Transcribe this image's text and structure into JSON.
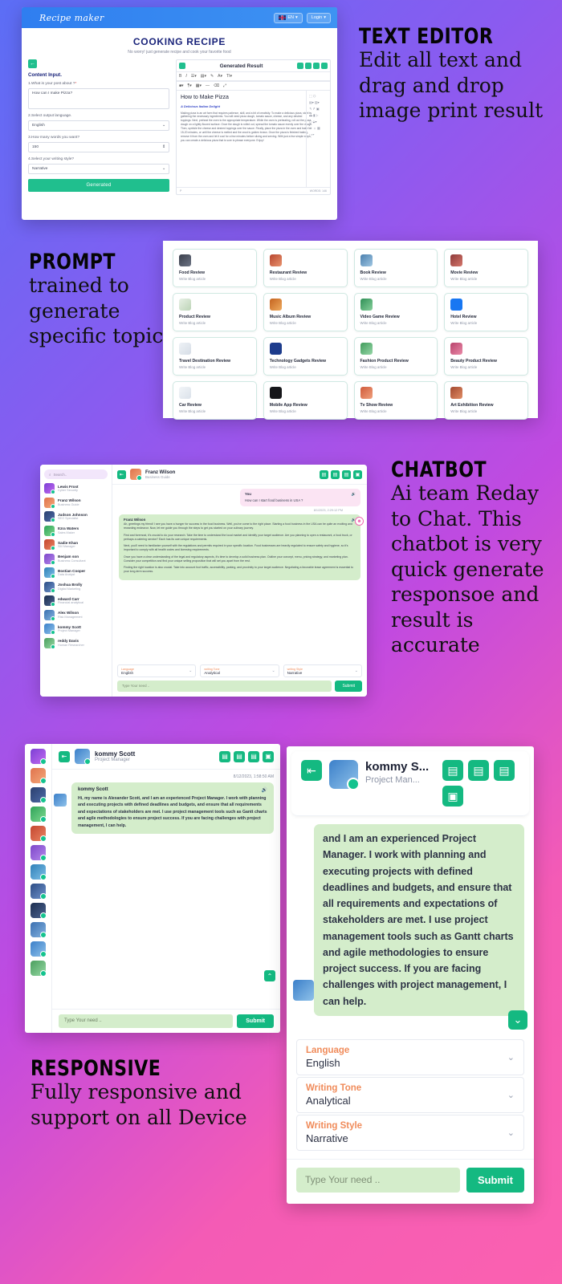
{
  "marketing": [
    {
      "title": "TEXT EDITOR",
      "body": "Edit all text and drag and drop image print result"
    },
    {
      "title": "PROMPT",
      "body": "trained to generate specific topic"
    },
    {
      "title": "CHATBOT",
      "body": "Ai team Reday to Chat. This chatbot is very quick generate responsoe and result is accurate"
    },
    {
      "title": "RESPONSIVE",
      "body": "Fully responsive and support on all Device"
    }
  ],
  "app": {
    "logo": "Recipe maker",
    "lang_button": "EN",
    "login_button": "Login",
    "hero_title": "COOKING RECIPE",
    "hero_sub": "No worry! just generate recipe and cook your favorite food",
    "content_input_label": "Content Input.",
    "field1_label": "1.What is your post about ?",
    "field1_required": "*",
    "field1_value": "How can I make Pizza?",
    "field2_label": "2.Select output language.",
    "field2_value": "English",
    "field3_label": "3.How many words you want?",
    "field3_value": "150",
    "field4_label": "4.Select your writing style?",
    "field4_value": "Narrative",
    "generate_button": "Generated",
    "result_title": "Generated Result",
    "doc_heading": "How to Make Pizza",
    "doc_subheading": "A Delicious Italian Delight",
    "doc_body": "Making pizza is an art form that requires patience, skill, and a bit of creativity. To make a delicious pizza, start by gathering the necessary ingredients. You will need pizza dough, tomato sauce, cheese, and any desired toppings. Next, preheat the oven to the appropriate temperature. While the oven is preheating, roll out the pizza dough on a lightly floured surface. Once the dough is rolled out, spread the tomato sauce evenly over the dough. Then, sprinkle the cheese and desired toppings over the sauce. Finally, place the pizza in the oven and bake for 15-20 minutes, or until the cheese is melted and the crust is golden brown. Once the pizza is finished baking, remove it from the oven and let it cool for a few minutes before slicing and serving. With just a few simple steps, you can create a delicious pizza that is sure to please everyone. Enjoy!",
    "word_count": "40",
    "footer_left": "P",
    "footer_right": "WORDS: 146"
  },
  "prompt_cards": {
    "subtitle": "Write Blog article",
    "items": [
      {
        "title": "Food Review",
        "icon": "ci1"
      },
      {
        "title": "Restaurant Review",
        "icon": "ci2"
      },
      {
        "title": "Book Review",
        "icon": "ci3"
      },
      {
        "title": "Movie Review",
        "icon": "ci4"
      },
      {
        "title": "Product Review",
        "icon": "ci5"
      },
      {
        "title": "Music Album Review",
        "icon": "ci6"
      },
      {
        "title": "Video Game Review",
        "icon": "ci7"
      },
      {
        "title": "Hotel Review",
        "icon": "ci8"
      },
      {
        "title": "Travel Destination Review",
        "icon": "ci9"
      },
      {
        "title": "Technology Gadgets Review",
        "icon": "ci10"
      },
      {
        "title": "Fashion Product Review",
        "icon": "ci11"
      },
      {
        "title": "Beauty Product Review",
        "icon": "ci12"
      },
      {
        "title": "Car Review",
        "icon": "ci13"
      },
      {
        "title": "Mobile App Review",
        "icon": "ci14"
      },
      {
        "title": "Tv Show Review",
        "icon": "ci15"
      },
      {
        "title": "Art Exhibition Review",
        "icon": "ci16"
      }
    ]
  },
  "chatbot": {
    "search_placeholder": "Search..",
    "contacts": [
      {
        "name": "Lewis Frost",
        "role": "Cyber Security",
        "av": "av1"
      },
      {
        "name": "Franz Wilson",
        "role": "Business Guide",
        "av": "av2"
      },
      {
        "name": "Judson Johnson",
        "role": "SEO Specialist",
        "av": "av3"
      },
      {
        "name": "Ezra Waters",
        "role": "Sales Maker",
        "av": "av4"
      },
      {
        "name": "Sadie Khan",
        "role": "SM Manager",
        "av": "av5"
      },
      {
        "name": "Benjam son",
        "role": "Business Consultant",
        "av": "av6"
      },
      {
        "name": "Bostian Cooper",
        "role": "Data Analyst",
        "av": "av7"
      },
      {
        "name": "Joshua Brolly",
        "role": "Digital Marketing",
        "av": "av8"
      },
      {
        "name": "edward Carr",
        "role": "Financial analytical",
        "av": "av9"
      },
      {
        "name": "Alex Wilson",
        "role": "Risk Management",
        "av": "av10"
      },
      {
        "name": "kommy Scott",
        "role": "Project Manager",
        "av": "av11"
      },
      {
        "name": "reddy Davis",
        "role": "Human Researcher",
        "av": "av12"
      }
    ],
    "header_name": "Franz Wilson",
    "header_role": "Business Guide",
    "user_label": "You",
    "user_message": "How can I start  food business in USA ?",
    "timestamp": "8/1/2023, 2:29:12 PM",
    "bot_name": "Franz Wilson",
    "bot_paragraphs": [
      "Ah, greetings my friend! I see you have a hunger for success in the food business. Well, you've come to the right place. Starting a food business in the USA can be quite an exciting and rewarding endeavor. Now, let me guide you through the steps to get you started on your culinary journey.",
      "First and foremost, it's crucial to do your research. Take the time to understand the local market and identify your target audience. Are you planning to open a restaurant, a food truck, or perhaps a catering service? Each has its own unique requirements.",
      "Next, you'll need to familiarize yourself with the regulations and permits required in your specific location. Food businesses are heavily regulated to ensure safety and hygiene, so it's important to comply with all health codes and licensing requirements.",
      "Once you have a clear understanding of the legal and regulatory aspects, it's time to develop a solid business plan. Outline your concept, menu, pricing strategy, and marketing plan. Consider your competition and find your unique selling proposition that will set you apart from the rest.",
      "Finding the right location is also crucial. Take into account foot traffic, accessibility, parking, and proximity to your target audience. Negotiating a favorable lease agreement is essential to your long-term success."
    ],
    "selects": [
      {
        "label": "Language",
        "value": "English"
      },
      {
        "label": "writing Tone",
        "value": "Analytical"
      },
      {
        "label": "writing Style",
        "value": "Narrative"
      }
    ],
    "input_placeholder": "Type Your need ..",
    "submit_label": "Submit"
  },
  "tablet": {
    "header_name": "kommy Scott",
    "header_role": "Project Manager",
    "timestamp": "8/12/2023, 1:58:50 AM",
    "bot_name": "kommy Scott",
    "message": "Hi, my name is Alexander Scott, and I am an experienced Project Manager. I work with planning and executing projects with defined deadlines and budgets, and ensure that all requirements and expectations of stakeholders are met. I use project management tools such as Gantt charts and agile methodologies to ensure project success. If you are facing challenges with project management, I can help.",
    "input_placeholder": "Type Your need ..",
    "submit_label": "Submit"
  },
  "mobile": {
    "header_name": "kommy S...",
    "header_role": "Project Man...",
    "message": "and I am an experienced Project Manager. I work with planning and executing projects with defined deadlines and budgets, and ensure that all requirements and expectations of stakeholders are met. I use project management tools such as Gantt charts and agile methodologies to ensure project success. If you are facing challenges with project management, I can help.",
    "selects": [
      {
        "label": "Language",
        "value": "English"
      },
      {
        "label": "Writing Tone",
        "value": "Analytical"
      },
      {
        "label": "Writing Style",
        "value": "Narrative"
      }
    ],
    "input_placeholder": "Type Your need ..",
    "submit_label": "Submit"
  },
  "colors": {
    "accent_green": "#14b981",
    "brand_blue": "#2d8cf0",
    "orange_label": "#f08b5a",
    "bubble_green": "#d4edcb",
    "bubble_pink": "#fbe4f3"
  }
}
